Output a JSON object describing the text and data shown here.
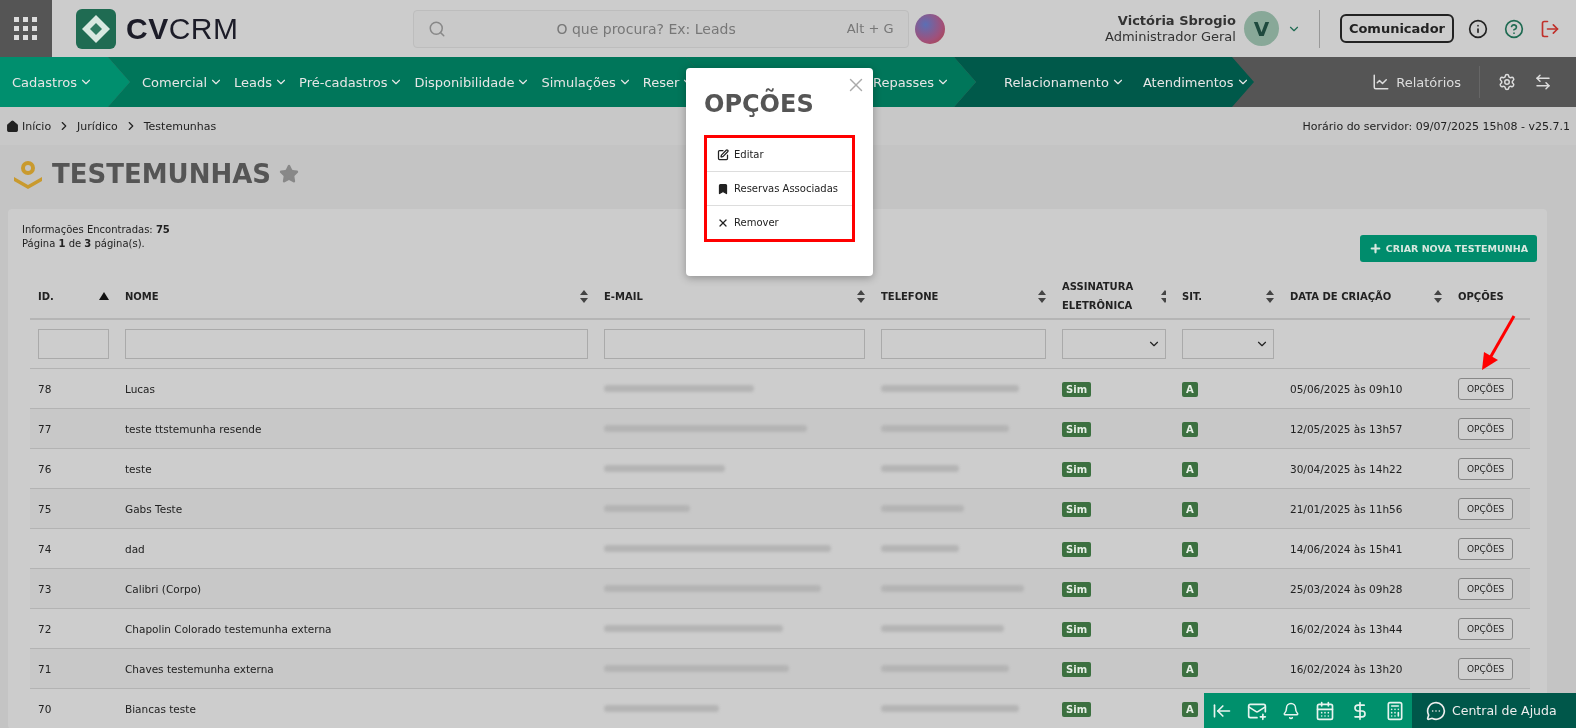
{
  "header": {
    "logo": "**CV**CRM",
    "search": {
      "placeholder": "O que procura? Ex: Leads",
      "shortcut": "Alt + G"
    },
    "user": {
      "name": "Victória Sbrogio",
      "role": "Administrador Geral",
      "initial": "V"
    },
    "communicator": "Comunicador"
  },
  "nav": {
    "segments": [
      {
        "kind": "light",
        "items": [
          "Cadastros"
        ]
      },
      {
        "kind": "mid",
        "items": [
          "Comercial",
          "Leads",
          "Pré-cadastros",
          "Disponibilidade",
          "Simulações",
          "Reser"
        ]
      },
      {
        "kind": "mid",
        "items": [
          "Repasses"
        ]
      },
      {
        "kind": "dark",
        "items": [
          "Relacionamento",
          "Atendimentos"
        ]
      }
    ],
    "reports": "Relatórios"
  },
  "breadcrumb": [
    "Início",
    "Jurídico",
    "Testemunhas"
  ],
  "server_time": "Horário do servidor: 09/07/2025 15h08 - v25.7.1",
  "title": "TESTEMUNHAS",
  "info": [
    "Informações Encontradas: **75**",
    "Página **1** de **3** página(s)."
  ],
  "create_button": "CRIAR NOVA TESTEMUNHA",
  "table": {
    "columns": [
      {
        "label": "ID.",
        "sortable": true,
        "sorted": true,
        "kind": "text"
      },
      {
        "label": "NOME",
        "sortable": true,
        "sorted": false,
        "kind": "text"
      },
      {
        "label": "E-MAIL",
        "sortable": true,
        "sorted": false,
        "kind": "text"
      },
      {
        "label": "TELEFONE",
        "sortable": true,
        "sorted": false,
        "kind": "text"
      },
      {
        "label": "ASSINATURA ELETRÔNICA",
        "sortable": true,
        "sorted": false,
        "kind": "select"
      },
      {
        "label": "SIT.",
        "sortable": true,
        "sorted": false,
        "kind": "select"
      },
      {
        "label": "DATA DE CRIAÇÃO",
        "sortable": true,
        "sorted": false,
        "kind": "none"
      },
      {
        "label": "OPÇÕES",
        "sortable": false,
        "kind": "none"
      }
    ],
    "rows": [
      {
        "id": "78",
        "name": "Lucas",
        "signature": "Sim",
        "status": "A",
        "created": "05/06/2025 às 09h10",
        "options": "OPÇÕES"
      },
      {
        "id": "77",
        "name": "teste ttstemunha resende",
        "signature": "Sim",
        "status": "A",
        "created": "12/05/2025 às 13h57",
        "options": "OPÇÕES"
      },
      {
        "id": "76",
        "name": "teste",
        "signature": "Sim",
        "status": "A",
        "created": "30/04/2025 às 14h22",
        "options": "OPÇÕES"
      },
      {
        "id": "75",
        "name": "Gabs Teste",
        "signature": "Sim",
        "status": "A",
        "created": "21/01/2025 às 11h56",
        "options": "OPÇÕES"
      },
      {
        "id": "74",
        "name": "dad",
        "signature": "Sim",
        "status": "A",
        "created": "14/06/2024 às 15h41",
        "options": "OPÇÕES"
      },
      {
        "id": "73",
        "name": "Calibri (Corpo)",
        "signature": "Sim",
        "status": "A",
        "created": "25/03/2024 às 09h28",
        "options": "OPÇÕES"
      },
      {
        "id": "72",
        "name": "Chapolin Colorado testemunha externa",
        "signature": "Sim",
        "status": "A",
        "created": "16/02/2024 às 13h44",
        "options": "OPÇÕES"
      },
      {
        "id": "71",
        "name": "Chaves testemunha externa",
        "signature": "Sim",
        "status": "A",
        "created": "16/02/2024 às 13h20",
        "options": "OPÇÕES"
      },
      {
        "id": "70",
        "name": "Biancas teste",
        "signature": "Sim",
        "status": "A"
      }
    ]
  },
  "modal": {
    "title": "OPÇÕES",
    "items": [
      {
        "label": "Editar",
        "kind": "edit"
      },
      {
        "label": "Reservas Associadas",
        "kind": "bookmark"
      },
      {
        "label": "Remover",
        "kind": "remove"
      }
    ]
  },
  "help_bar": {
    "label": "Central de Ajuda"
  }
}
